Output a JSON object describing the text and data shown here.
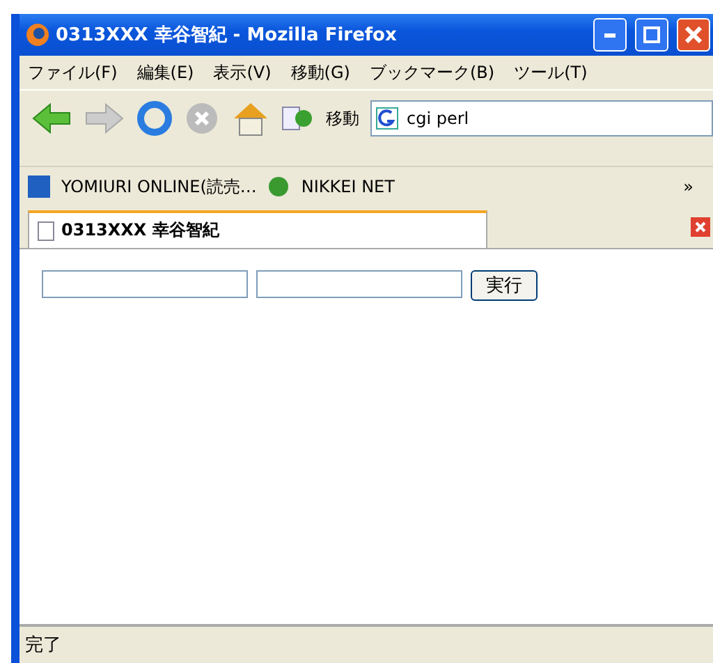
{
  "window": {
    "title": "0313XXX 幸谷智紀 - Mozilla Firefox"
  },
  "menu": [
    "ファイル(F)",
    "編集(E)",
    "表示(V)",
    "移動(G)",
    "ブックマーク(B)",
    "ツール(T)"
  ],
  "toolbar": {
    "go_label": "移動",
    "address": "cgi perl"
  },
  "bookmarks": [
    {
      "label": "YOMIURI ONLINE(読売…"
    },
    {
      "label": "NIKKEI NET"
    }
  ],
  "bookmarks_more": "»",
  "tabs": [
    {
      "label": "0313XXX 幸谷智紀",
      "selected": true
    }
  ],
  "form": {
    "fields": [
      {
        "kind": "text"
      },
      {
        "kind": "text"
      }
    ],
    "button": "実行"
  },
  "status_bar": "完了"
}
